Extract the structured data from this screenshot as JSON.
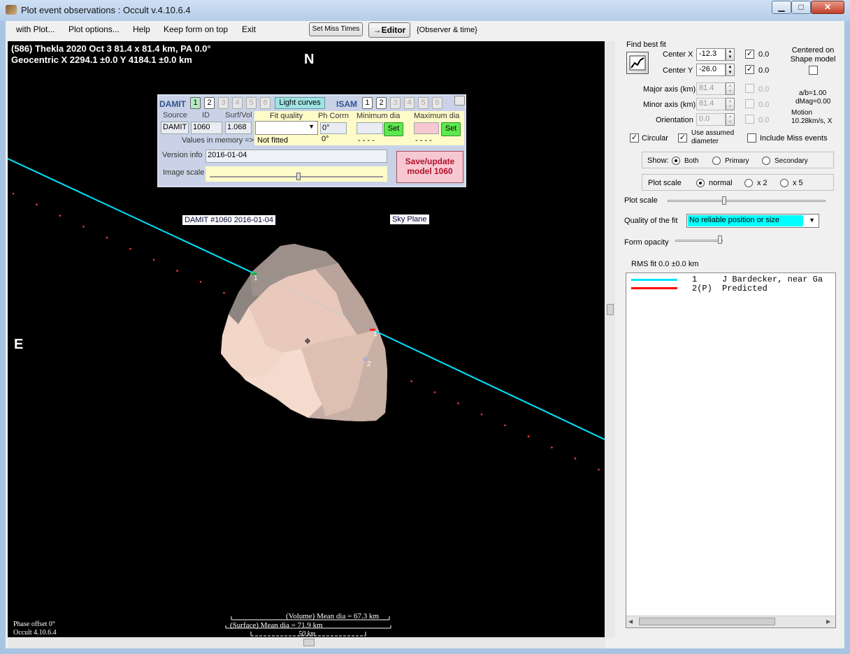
{
  "window": {
    "title": "Plot event observations : Occult v.4.10.6.4",
    "min_glyph": "▁",
    "max_glyph": "□",
    "close_glyph": "✕"
  },
  "menu": {
    "items": [
      "with Plot...",
      "Plot options...",
      "Help",
      "Keep form on top",
      "Exit"
    ],
    "set_miss_times": "Set Miss Times",
    "editor": "→Editor",
    "observer_time": "{Observer & time}"
  },
  "plot": {
    "header_line1": "(586) Thekla  2020 Oct 3   81.4 x 81.4 km, PA 0.0°",
    "header_line2": "Geocentric  X  2294.1 ±0.0   Y 4184.1 ±0.0 km",
    "north": "N",
    "east": "E",
    "damit_label": "DAMIT #1060 2016-01-04",
    "sky_label": "Sky Plane",
    "chord1_label": "1",
    "chord1_end_label": "1",
    "chord2_label": "2",
    "phase_offset": "Phase offset 0°",
    "occult_version": "Occult 4.10.6.4",
    "volume_dia": "(Volume) Mean dia = 67.3 km",
    "surface_dia": "(Surface) Mean dia = 71.9 km",
    "scale_bar": "50 km"
  },
  "damit_panel": {
    "damit_title": "DAMIT",
    "damit_buttons": [
      "1",
      "2",
      "3",
      "4",
      "5",
      "6"
    ],
    "light_curves": "Light curves",
    "isam_title": "ISAM",
    "isam_buttons": [
      "1",
      "2",
      "3",
      "4",
      "5",
      "6"
    ],
    "col_source": "Source",
    "col_id": "ID",
    "col_surfvol": "Surf/Vol",
    "source_value": "DAMIT",
    "id_value": "1060",
    "surfvol_value": "1.068",
    "fit_quality_label": "Fit quality",
    "ph_corrn_label": "Ph Corrn",
    "min_dia_label": "Minimum dia",
    "max_dia_label": "Maximum dia",
    "ph_corrn_value": "0°",
    "set_label": "Set",
    "values_in_memory": "Values in memory =>",
    "not_fitted": "Not fitted",
    "mem_ph": "0°",
    "mem_min": "- - - -",
    "mem_max": "- - - -",
    "version_info_label": "Version info",
    "version_info_value": "2016-01-04",
    "image_scale_label": "Image scale",
    "save_update": "Save/update model 1060"
  },
  "right_panel": {
    "find_best_fit": "Find best fit",
    "center_x_label": "Center X",
    "center_x_value": "-12.3",
    "center_x_fixed": "0.0",
    "center_y_label": "Center Y",
    "center_y_value": "-26.0",
    "center_y_fixed": "0.0",
    "centered_on_shape": "Centered on Shape model",
    "major_axis_label": "Major axis (km)",
    "major_axis_value": "81.4",
    "major_axis_fixed": "0.0",
    "minor_axis_label": "Minor axis (km)",
    "minor_axis_value": "81.4",
    "minor_axis_fixed": "0.0",
    "orientation_label": "Orientation",
    "orientation_value": "0.0",
    "orientation_fixed": "0.0",
    "ab_ratio": "a/b=1.00",
    "dmag": "dMag=0.00",
    "motion_label": "Motion",
    "motion_value": "10.28km/s, X",
    "circular": "Circular",
    "use_assumed": "Use assumed diameter",
    "include_miss": "Include Miss events",
    "show_label": "Show:",
    "show_both": "Both",
    "show_primary": "Primary",
    "show_secondary": "Secondary",
    "plot_scale_group": "Plot scale",
    "scale_normal": "normal",
    "scale_x2": "x 2",
    "scale_x5": "x 5",
    "plot_scale_slider": "Plot scale",
    "quality_label": "Quality of the fit",
    "quality_value": "No reliable position or size",
    "form_opacity": "Form opacity",
    "rms_fit": "RMS fit 0.0 ±0.0 km",
    "list": [
      {
        "num": "1",
        "text": "J Bardecker, near Ga",
        "color": "#00e5ff"
      },
      {
        "num": "2(P)",
        "text": "Predicted",
        "color": "#ff0000"
      }
    ]
  },
  "colors": {
    "chord": "#00e5ff",
    "predicted_dots": "#ff3b3b",
    "asteroid_light": "#f3d7c8",
    "asteroid_dark": "#8f8580"
  }
}
